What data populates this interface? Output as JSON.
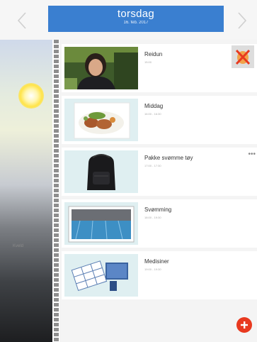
{
  "header": {
    "day_name": "torsdag",
    "date": "16. feb. 2017",
    "prev_icon": "chevron-left-icon",
    "next_icon": "chevron-right-icon"
  },
  "timeline": {
    "period_label": "Kveld",
    "sun_icon": "sun-icon"
  },
  "activities": [
    {
      "title": "Reidun",
      "time": "15:00",
      "image": "person-photo",
      "action_icon": "delete-icon"
    },
    {
      "title": "Middag",
      "time": "16:00 - 16:30",
      "image": "dinner-plate-photo"
    },
    {
      "title": "Pakke svømme tøy",
      "time": "17:00 - 17:30",
      "image": "backpack-photo",
      "action_icon": "more-dots-icon"
    },
    {
      "title": "Svømming",
      "time": "18:00 - 19:30",
      "image": "swimming-pool-photo"
    },
    {
      "title": "Medisiner",
      "time": "19:00 - 19:30",
      "image": "medicine-photo"
    }
  ],
  "fab": {
    "icon": "plus-icon"
  },
  "colors": {
    "accent": "#3a7fd0",
    "danger": "#e8391f"
  }
}
